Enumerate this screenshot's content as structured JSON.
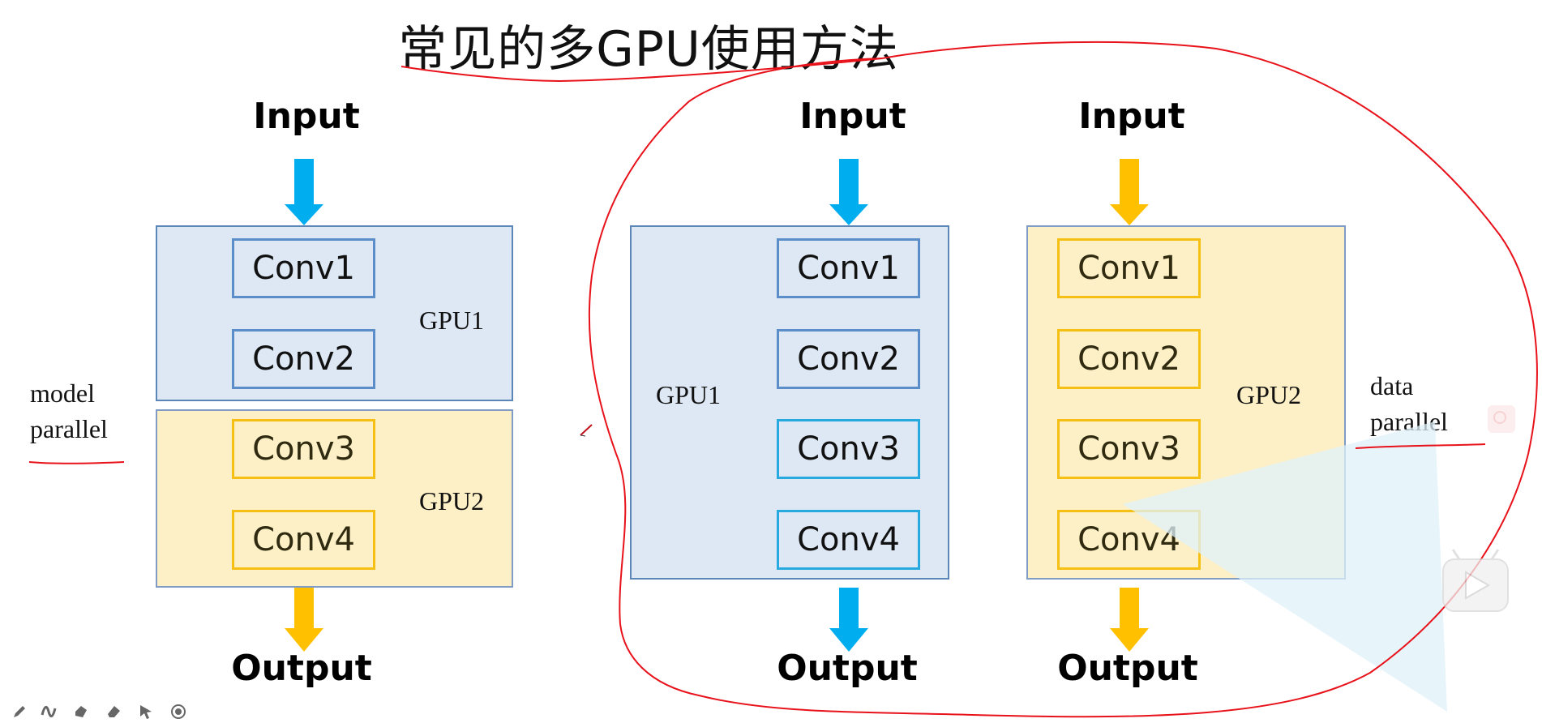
{
  "title": "常见的多GPU使用方法",
  "model_parallel": {
    "input_label": "Input",
    "output_label": "Output",
    "gpu1_label": "GPU1",
    "gpu2_label": "GPU2",
    "gpu1_layers": [
      "Conv1",
      "Conv2"
    ],
    "gpu2_layers": [
      "Conv3",
      "Conv4"
    ],
    "note_line1": "model",
    "note_line2": "parallel"
  },
  "data_parallel": {
    "replica1": {
      "input_label": "Input",
      "output_label": "Output",
      "gpu_label": "GPU1",
      "layers": [
        "Conv1",
        "Conv2",
        "Conv3",
        "Conv4"
      ]
    },
    "replica2": {
      "input_label": "Input",
      "output_label": "Output",
      "gpu_label": "GPU2",
      "layers": [
        "Conv1",
        "Conv2",
        "Conv3",
        "Conv4"
      ]
    },
    "note_line1": "data",
    "note_line2": "parallel"
  },
  "colors": {
    "blue_arrow": "#00aeef",
    "yellow_arrow": "#ffc000",
    "annotation_red": "#e8121b",
    "gpu_blue_bg": "#dde8f4",
    "gpu_yellow_bg": "#fdf0c6"
  },
  "toolbar_icons": [
    "pen-icon",
    "curve-icon",
    "highlighter-icon",
    "eraser-icon",
    "pointer-icon",
    "record-icon"
  ]
}
